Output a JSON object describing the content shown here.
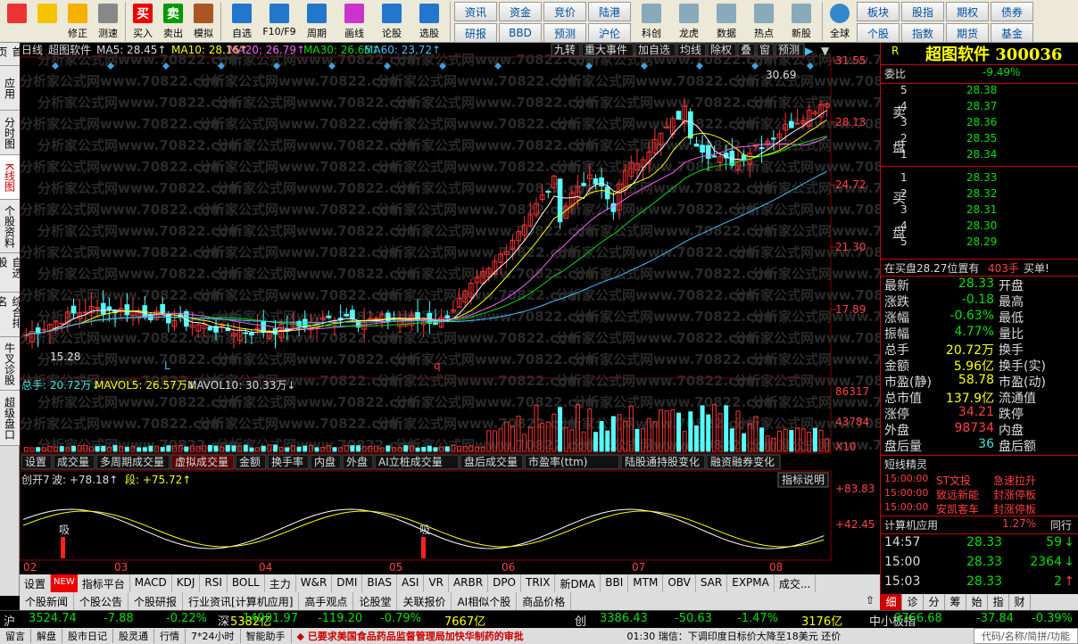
{
  "toolbar": {
    "buttons": [
      {
        "label": "",
        "icon": "app-grid-icon"
      },
      {
        "label": "",
        "icon": "back-arrow-icon"
      },
      {
        "label": "修正",
        "icon": "thumb-up-icon"
      },
      {
        "label": "测速",
        "icon": "clock-icon"
      },
      {
        "label": "买入",
        "icon": "buy-icon",
        "char": "买"
      },
      {
        "label": "卖出",
        "icon": "sell-icon",
        "char": "卖"
      },
      {
        "label": "模拟",
        "icon": "hammer-icon"
      },
      {
        "label": "自选",
        "icon": "star-icon"
      },
      {
        "label": "F10/F9",
        "icon": "f10-icon"
      },
      {
        "label": "周期",
        "icon": "period-icon"
      },
      {
        "label": "画线",
        "icon": "pencil-icon"
      },
      {
        "label": "论股",
        "icon": "discuss-icon"
      },
      {
        "label": "选股",
        "icon": "select-stock-icon"
      }
    ],
    "grid1": [
      "资讯",
      "资金",
      "竞价",
      "陆港",
      "研报",
      "BBD",
      "预测",
      "沪伦"
    ],
    "buttons2": [
      {
        "label": "科创"
      },
      {
        "label": "龙虎"
      },
      {
        "label": "数据"
      },
      {
        "label": "热点"
      },
      {
        "label": "新股"
      }
    ],
    "buttons3": [
      {
        "label": "全球"
      }
    ],
    "grid2": [
      "板块",
      "股指",
      "期权",
      "债券",
      "个股",
      "指数",
      "期货",
      "基金"
    ]
  },
  "sidetabs": [
    "首页",
    "应用",
    "分时图",
    "K线图",
    "个股资料",
    "自选股",
    "综合排名",
    "牛叉诊股",
    "超级盘口"
  ],
  "chart": {
    "header": {
      "period": "日线",
      "name": "超图软件",
      "ma5": "MA5: 28.45↑",
      "ma10": "MA10: 28.16↑",
      "ma20": "MA20: 26.79↑",
      "ma30": "MA30: 26.65↑",
      "ma60": "MA60: 23.72↑"
    },
    "toptabs": [
      "九转",
      "重大事件",
      "加自选",
      "均线",
      "除权",
      "叠",
      "窗",
      "预测"
    ],
    "price_axis": [
      "31.55",
      "28.13",
      "24.72",
      "21.30",
      "17.89"
    ],
    "high_label": "30.69",
    "low_label": "15.28",
    "markers": [
      "L",
      "q"
    ],
    "vol_header": {
      "total": "总手: 20.72万↓",
      "mavol5": "MAVOL5: 26.57万↓",
      "mavol10": "MAVOL10: 30.33万↓"
    },
    "vol_axis": [
      "86317",
      "43784",
      "X10"
    ],
    "ind_tabs": [
      "设置",
      "成交量",
      "多周期成交量",
      "虚拟成交量",
      "金额",
      "换手率",
      "内盘",
      "外盘",
      "AI立桩成交量",
      "盘后成交量",
      "市盈率(ttm)",
      "陆股通持股变化",
      "融资融券变化"
    ],
    "osc_header": {
      "name": "创开7",
      "wave": "波: +78.18↑",
      "seg": "段: +75.72↑"
    },
    "osc_help": "指标说明",
    "osc_axis": [
      "+83.83",
      "+42.45"
    ],
    "osc_marks": [
      "吸",
      "吸"
    ],
    "months": [
      "02",
      "03",
      "04",
      "05",
      "06",
      "07",
      "08"
    ],
    "watermark": "分析家公式网www.70822.com"
  },
  "bottom_indicators": [
    "设置",
    "NEW",
    "指标平台",
    "MACD",
    "KDJ",
    "RSI",
    "BOLL",
    "主力",
    "W&R",
    "DMI",
    "BIAS",
    "ASI",
    "VR",
    "ARBR",
    "DPO",
    "TRIX",
    "新DMA",
    "BBI",
    "MTM",
    "OBV",
    "SAR",
    "EXPMA",
    "成交..."
  ],
  "news_tabs": [
    "个股新闻",
    "个股公告",
    "个股研报",
    "行业资讯[计算机应用]",
    "高手观点",
    "论股堂",
    "关联报价",
    "AI相似个股",
    "商品价格"
  ],
  "right": {
    "title": "超图软件 300036",
    "r_mark": "R",
    "weibi_label": "委比",
    "weibi": "-9.49%",
    "sell": [
      {
        "n": "5",
        "p": "28.38"
      },
      {
        "n": "4",
        "p": "28.37"
      },
      {
        "n": "3",
        "p": "28.36"
      },
      {
        "n": "2",
        "p": "28.35"
      },
      {
        "n": "1",
        "p": "28.34"
      }
    ],
    "sell_label": "卖盘",
    "buy": [
      {
        "n": "1",
        "p": "28.33"
      },
      {
        "n": "2",
        "p": "28.32"
      },
      {
        "n": "3",
        "p": "28.31"
      },
      {
        "n": "4",
        "p": "28.30"
      },
      {
        "n": "5",
        "p": "28.29"
      }
    ],
    "buy_label": "买盘",
    "inbuy": {
      "text": "在买盘28.27位置有",
      "qty": "403手",
      "tag": "买单!"
    },
    "stats": [
      {
        "l": "最新",
        "v": "28.33",
        "l2": "开盘"
      },
      {
        "l": "涨跌",
        "v": "-0.18",
        "l2": "最高"
      },
      {
        "l": "涨幅",
        "v": "-0.63%",
        "l2": "最低"
      },
      {
        "l": "振幅",
        "v": "4.77%",
        "l2": "量比"
      },
      {
        "l": "总手",
        "v": "20.72万",
        "l2": "换手"
      },
      {
        "l": "金额",
        "v": "5.96亿",
        "l2": "换手(实)"
      },
      {
        "l": "市盈(静)",
        "v": "58.78",
        "l2": "市盈(动)"
      },
      {
        "l": "总市值",
        "v": "137.9亿",
        "l2": "流通值"
      },
      {
        "l": "涨停",
        "v": "34.21",
        "l2": "跌停"
      },
      {
        "l": "外盘",
        "v": "98734",
        "l2": "内盘"
      },
      {
        "l": "盘后量",
        "v": "36",
        "l2": "盘后额"
      }
    ],
    "short_title": "短线精灵",
    "short": [
      {
        "t": "15:00:00",
        "n": "ST文投",
        "e": "急速拉升"
      },
      {
        "t": "15:00:00",
        "n": "致远新能",
        "e": "封涨停板"
      },
      {
        "t": "15:00:00",
        "n": "安凯客车",
        "e": "封涨停板"
      }
    ],
    "industry": {
      "name": "计算机应用",
      "pct": "1.27%",
      "tag": "同行"
    },
    "ticks": [
      {
        "t": "14:57",
        "p": "28.33",
        "q": "59",
        "dir": "down"
      },
      {
        "t": "15:00",
        "p": "28.33",
        "q": "2364",
        "dir": "down"
      },
      {
        "t": "15:03",
        "p": "28.33",
        "q": "2",
        "dir": "up"
      }
    ],
    "bottom_tabs": [
      "细",
      "诊",
      "分",
      "筹",
      "始",
      "指",
      "财"
    ]
  },
  "indices": [
    {
      "name": "沪",
      "val": "3524.74",
      "chg": "-7.88",
      "pct": "-0.22%",
      "amt": "5382亿"
    },
    {
      "name": "深",
      "val": "14901.97",
      "chg": "-119.20",
      "pct": "-0.79%",
      "amt": "7667亿"
    },
    {
      "name": "创",
      "val": "3386.43",
      "chg": "-50.63",
      "pct": "-1.47%",
      "amt": "3176亿"
    },
    {
      "name": "中小板指",
      "val": "9766.68",
      "chg": "-37.84",
      "pct": "-0.39%",
      "amt": ""
    }
  ],
  "status": {
    "items": [
      "留言",
      "解盘",
      "股市日记",
      "股灵通",
      "行情",
      "7*24小时",
      "智能助手"
    ],
    "news": "◆ 已要求美国食品药品监督管理局加快华制药的审批",
    "news2": "01:30 瑞信：下调印度日标价大降至18美元 还价",
    "right": "代码/名称/简拼/功能"
  }
}
